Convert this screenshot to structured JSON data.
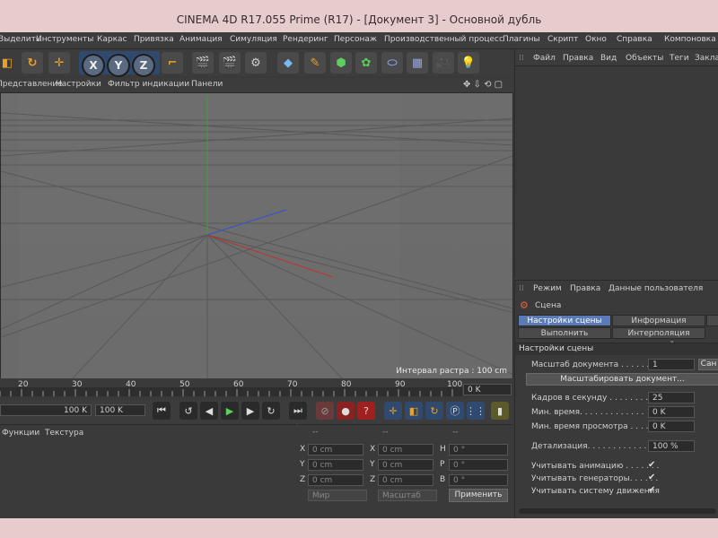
{
  "window": {
    "title": "CINEMA 4D R17.055 Prime (R17) - [Документ 3] - Основной дубль"
  },
  "menubar": [
    "Выделить",
    "Инструменты",
    "Каркас",
    "Привязка",
    "Анимация",
    "Симуляция",
    "Рендеринг",
    "Персонаж",
    "Производственный процесс",
    "Плагины",
    "Скрипт",
    "Окно",
    "Справка",
    "Компоновка"
  ],
  "toolbar": {
    "axis_x": "X",
    "axis_y": "Y",
    "axis_z": "Z"
  },
  "viewport": {
    "menu": [
      "Представление",
      "Настройки",
      "Фильтр индикации",
      "Панели"
    ],
    "status": "Интервал растра : 100 cm"
  },
  "timeline": {
    "ticks": [
      "20",
      "30",
      "40",
      "50",
      "60",
      "70",
      "80",
      "90",
      "100"
    ],
    "current_frame": "0 K"
  },
  "transport": {
    "end_field": "100 K",
    "end_field2": "100 K"
  },
  "materials": {
    "menu": [
      "Функции",
      "Текстура"
    ]
  },
  "coords": {
    "header": [
      "--",
      "--",
      "--"
    ],
    "rows": [
      {
        "a": "X",
        "av": "0 cm",
        "b": "X",
        "bv": "0 cm",
        "c": "H",
        "cv": "0 °"
      },
      {
        "a": "Y",
        "av": "0 cm",
        "b": "Y",
        "bv": "0 cm",
        "c": "P",
        "cv": "0 °"
      },
      {
        "a": "Z",
        "av": "0 cm",
        "b": "Z",
        "bv": "0 cm",
        "c": "B",
        "cv": "0 °"
      }
    ],
    "mode_world": "Мир",
    "mode_scale": "Масштаб",
    "apply": "Применить"
  },
  "objects": {
    "menu": [
      "Файл",
      "Правка",
      "Вид",
      "Объекты",
      "Теги",
      "Заклад"
    ]
  },
  "attributes": {
    "menu": [
      "Режим",
      "Правка",
      "Данные пользователя"
    ],
    "object": "Сцена",
    "tabs": [
      "Настройки сцены",
      "Информация",
      "Выполнить",
      "Интерполяция ключей"
    ],
    "section": "Настройки сцены",
    "doc_scale_label": "Масштаб документа . . . . . . . .",
    "doc_scale_value": "1",
    "doc_scale_unit": "Сан",
    "scale_doc_button": "Масштабировать документ...",
    "fps_label": "Кадров в секунду . . . . . . . . . .",
    "fps_value": "25",
    "min_time_label": "Мин. время. . . . . . . . . . . . .",
    "min_time_value": "0 K",
    "min_preview_label": "Мин. время просмотра . . . . . .",
    "min_preview_value": "0 K",
    "detail_label": "Детализация. . . . . . . . . . . . . .",
    "detail_value": "100 %",
    "use_animation": "Учитывать анимацию . . . . . . .",
    "use_generators": "Учитывать генераторы. . . . . .",
    "use_motion": "Учитывать систему движения",
    "check": "✔"
  }
}
